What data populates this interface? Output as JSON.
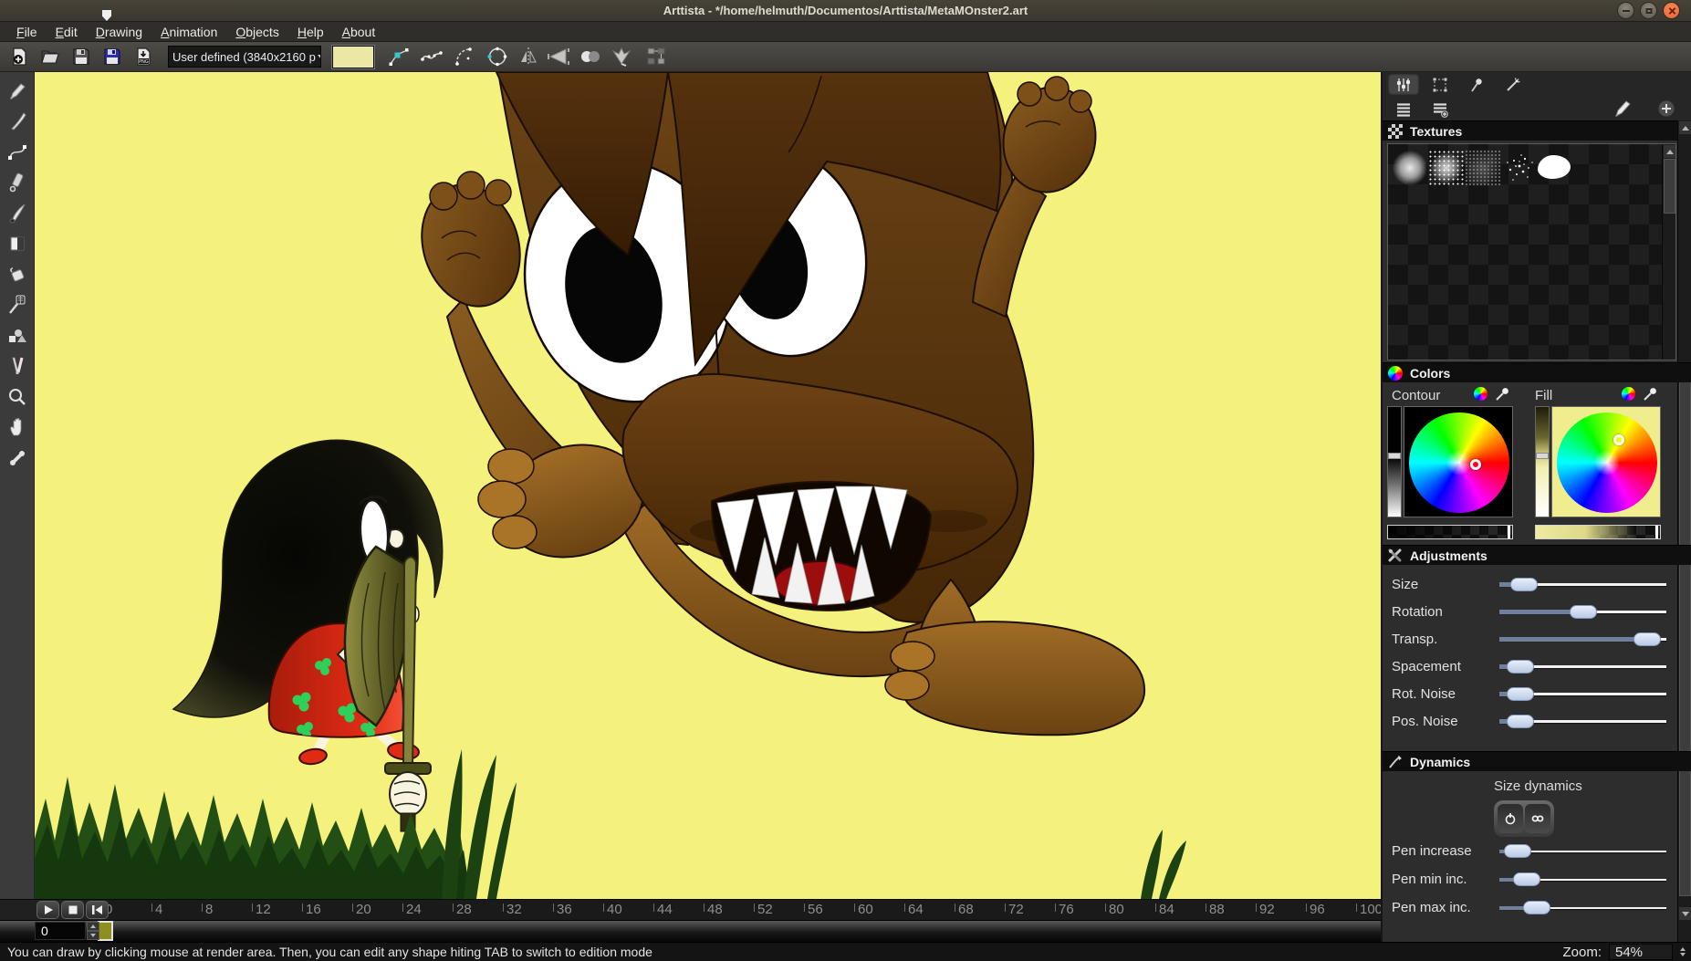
{
  "window": {
    "title": "Arttista - */home/helmuth/Documentos/Arttista/MetaMOnster2.art"
  },
  "menu": {
    "items": [
      "File",
      "Edit",
      "Drawing",
      "Animation",
      "Objects",
      "Help",
      "About"
    ]
  },
  "toolbar": {
    "preset_value": "User defined (3840x2160 p"
  },
  "colors": {
    "canvas_bg": "#f4f17c",
    "fill_swatch": "#ebe8a5",
    "accent_cyan": "#35c8cc",
    "dress_red": "#df2b14",
    "monster_brown": "#5b3a16",
    "grass_green": "#16380e",
    "tongue_red": "#9c0e0e",
    "keyframe": "#8f8f1f",
    "close_button": "#e66233",
    "slider_handle": "#b9c9e3"
  },
  "right_panel": {
    "textures": {
      "title": "Textures"
    },
    "colors_section": {
      "title": "Colors",
      "contour_label": "Contour",
      "fill_label": "Fill"
    },
    "adjustments": {
      "title": "Adjustments",
      "sliders": [
        {
          "label": "Size",
          "value": 0.08
        },
        {
          "label": "Rotation",
          "value": 0.5
        },
        {
          "label": "Transp.",
          "value": 0.96
        },
        {
          "label": "Spacement",
          "value": 0.05
        },
        {
          "label": "Rot. Noise",
          "value": 0.05
        },
        {
          "label": "Pos. Noise",
          "value": 0.05
        }
      ]
    },
    "dynamics": {
      "title": "Dynamics",
      "size_dynamics_label": "Size dynamics",
      "sliders": [
        {
          "label": "Pen increase",
          "value": 0.03
        },
        {
          "label": "Pen min inc.",
          "value": 0.1
        },
        {
          "label": "Pen max inc.",
          "value": 0.17
        }
      ]
    }
  },
  "timeline": {
    "current_frame": "0",
    "frame_labels": [
      "0",
      "4",
      "8",
      "12",
      "16",
      "20",
      "24",
      "28",
      "32",
      "36",
      "40",
      "44",
      "48",
      "52",
      "56",
      "60",
      "64",
      "68",
      "72",
      "76",
      "80",
      "84",
      "88",
      "92",
      "96",
      "100"
    ]
  },
  "status": {
    "message": "You can draw by clicking mouse at render area. Then, you can edit any shape hiting TAB to switch to edition mode",
    "zoom_label": "Zoom:",
    "zoom_value": "54%"
  }
}
